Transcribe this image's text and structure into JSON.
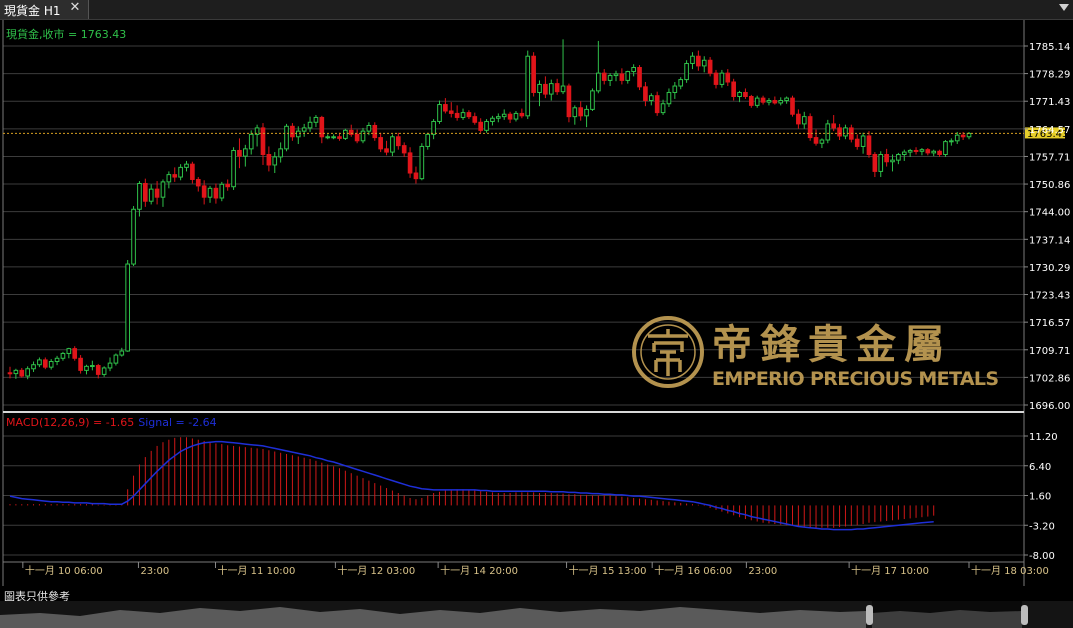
{
  "window": {
    "tab_title": "現貨金 H1",
    "close_icon": "close-icon",
    "dropdown_icon": "triangle-down-icon"
  },
  "price_panel": {
    "legend_symbol": "現貨金,收市",
    "legend_value": "1763.43",
    "y_ticks": [
      "1785.14",
      "1778.29",
      "1771.43",
      "1764.57",
      "1757.71",
      "1750.86",
      "1744.00",
      "1737.14",
      "1730.29",
      "1723.43",
      "1716.57",
      "1709.71",
      "1702.86",
      "1696.00"
    ],
    "current_price": "1763.43"
  },
  "macd_panel": {
    "legend_name": "MACD(12,26,9) = -1.65",
    "legend_signal": "Signal = -2.64",
    "y_ticks": [
      "11.20",
      "6.40",
      "1.60",
      "-3.20",
      "-8.00"
    ]
  },
  "x_ticks": [
    "十一月 10 06:00",
    "23:00",
    "十一月 11 10:00",
    "十一月 12 03:00",
    "十一月 14 20:00",
    "十一月 15 13:00",
    "十一月 16 06:00",
    "23:00",
    "十一月 17 10:00",
    "十一月 18 03:00"
  ],
  "watermark": {
    "brand_cn": "帝鋒貴金屬",
    "brand_en": "EMPERIO PRECIOUS METALS",
    "logo_icon": "emperio-logo-icon"
  },
  "disclaimer": "圖表只供參考",
  "colors": {
    "up": "#2fc14a",
    "down": "#e0151a",
    "grid": "#3c3c3c",
    "axis_text": "#ffffff",
    "legend_price": "#2fc14a",
    "macd_hist": "#d01818",
    "signal_line": "#1e2fd8",
    "current_line": "#d9a020",
    "current_tag": "#e7cf2a",
    "watermark_gold": "#c7a257",
    "xaxis_text": "#d9c38a"
  },
  "chart_data": {
    "type": "candlestick",
    "interval": "H1",
    "ylim": [
      1696.0,
      1788.0
    ],
    "candles": [
      [
        1704.0,
        1705.5,
        1702.6,
        1703.8
      ],
      [
        1703.8,
        1705.0,
        1702.5,
        1704.6
      ],
      [
        1704.6,
        1705.2,
        1702.8,
        1703.2
      ],
      [
        1703.2,
        1705.6,
        1702.4,
        1705.0
      ],
      [
        1705.0,
        1706.8,
        1704.2,
        1706.0
      ],
      [
        1706.0,
        1707.8,
        1705.4,
        1707.2
      ],
      [
        1707.2,
        1707.8,
        1704.9,
        1705.4
      ],
      [
        1705.4,
        1707.4,
        1704.8,
        1706.8
      ],
      [
        1706.8,
        1708.2,
        1705.9,
        1707.6
      ],
      [
        1707.6,
        1709.2,
        1707.0,
        1708.8
      ],
      [
        1708.8,
        1710.2,
        1707.6,
        1710.0
      ],
      [
        1710.0,
        1710.6,
        1707.0,
        1707.6
      ],
      [
        1707.6,
        1708.4,
        1703.8,
        1704.6
      ],
      [
        1704.6,
        1706.0,
        1703.6,
        1705.6
      ],
      [
        1705.6,
        1707.0,
        1704.6,
        1705.8
      ],
      [
        1705.8,
        1706.2,
        1702.6,
        1703.6
      ],
      [
        1703.6,
        1705.6,
        1703.0,
        1705.2
      ],
      [
        1705.2,
        1707.8,
        1704.4,
        1706.4
      ],
      [
        1706.4,
        1708.8,
        1705.8,
        1708.4
      ],
      [
        1708.4,
        1710.2,
        1708.0,
        1709.4
      ],
      [
        1709.4,
        1732.0,
        1709.2,
        1731.0
      ],
      [
        1731.0,
        1745.4,
        1730.5,
        1744.6
      ],
      [
        1744.6,
        1751.6,
        1742.8,
        1751.0
      ],
      [
        1751.0,
        1752.2,
        1745.2,
        1746.6
      ],
      [
        1746.6,
        1750.8,
        1745.8,
        1749.6
      ],
      [
        1749.6,
        1751.6,
        1745.8,
        1747.6
      ],
      [
        1747.6,
        1752.0,
        1745.2,
        1751.4
      ],
      [
        1751.4,
        1754.0,
        1749.8,
        1753.2
      ],
      [
        1753.2,
        1755.0,
        1751.4,
        1752.6
      ],
      [
        1752.6,
        1755.8,
        1751.8,
        1755.0
      ],
      [
        1755.0,
        1756.6,
        1754.0,
        1755.8
      ],
      [
        1755.8,
        1756.4,
        1751.0,
        1752.0
      ],
      [
        1752.0,
        1752.6,
        1749.0,
        1750.4
      ],
      [
        1750.4,
        1751.8,
        1745.8,
        1747.6
      ],
      [
        1747.6,
        1750.4,
        1746.2,
        1749.8
      ],
      [
        1749.8,
        1751.0,
        1746.0,
        1747.4
      ],
      [
        1747.4,
        1751.4,
        1746.6,
        1750.8
      ],
      [
        1750.8,
        1752.0,
        1749.2,
        1750.2
      ],
      [
        1750.2,
        1760.0,
        1749.4,
        1759.2
      ],
      [
        1759.2,
        1762.2,
        1754.8,
        1757.8
      ],
      [
        1757.8,
        1760.6,
        1755.2,
        1759.6
      ],
      [
        1759.6,
        1764.2,
        1758.2,
        1763.2
      ],
      [
        1763.2,
        1765.6,
        1760.2,
        1764.8
      ],
      [
        1764.8,
        1766.0,
        1755.6,
        1758.2
      ],
      [
        1758.2,
        1760.2,
        1754.0,
        1755.6
      ],
      [
        1755.6,
        1758.8,
        1753.6,
        1757.6
      ],
      [
        1757.6,
        1761.2,
        1756.2,
        1759.6
      ],
      [
        1759.6,
        1765.8,
        1759.0,
        1765.2
      ],
      [
        1765.2,
        1766.0,
        1761.6,
        1762.6
      ],
      [
        1762.6,
        1765.2,
        1760.8,
        1764.0
      ],
      [
        1764.0,
        1765.8,
        1762.6,
        1764.8
      ],
      [
        1764.8,
        1767.6,
        1763.8,
        1766.2
      ],
      [
        1766.2,
        1768.0,
        1765.0,
        1767.4
      ],
      [
        1767.4,
        1767.8,
        1761.0,
        1762.6
      ],
      [
        1762.6,
        1763.2,
        1762.0,
        1762.6
      ],
      [
        1762.6,
        1763.2,
        1762.0,
        1762.6
      ],
      [
        1762.6,
        1763.6,
        1761.6,
        1762.2
      ],
      [
        1762.2,
        1764.6,
        1761.8,
        1764.2
      ],
      [
        1764.2,
        1765.6,
        1762.6,
        1763.2
      ],
      [
        1763.2,
        1764.4,
        1761.0,
        1761.6
      ],
      [
        1761.6,
        1764.8,
        1761.0,
        1764.0
      ],
      [
        1764.0,
        1766.2,
        1763.0,
        1765.4
      ],
      [
        1765.4,
        1766.2,
        1761.6,
        1762.4
      ],
      [
        1762.4,
        1763.6,
        1758.8,
        1759.6
      ],
      [
        1759.6,
        1761.6,
        1758.0,
        1758.8
      ],
      [
        1758.8,
        1763.2,
        1757.8,
        1762.6
      ],
      [
        1762.6,
        1763.6,
        1759.4,
        1760.4
      ],
      [
        1760.4,
        1761.2,
        1757.6,
        1758.6
      ],
      [
        1758.6,
        1760.0,
        1752.4,
        1753.6
      ],
      [
        1753.6,
        1755.2,
        1751.0,
        1752.2
      ],
      [
        1752.2,
        1761.0,
        1751.8,
        1760.2
      ],
      [
        1760.2,
        1763.6,
        1759.4,
        1763.2
      ],
      [
        1763.2,
        1767.0,
        1762.0,
        1766.4
      ],
      [
        1766.4,
        1771.6,
        1765.8,
        1770.6
      ],
      [
        1770.6,
        1772.2,
        1768.4,
        1769.0
      ],
      [
        1769.0,
        1771.2,
        1767.4,
        1768.4
      ],
      [
        1768.4,
        1770.4,
        1766.6,
        1767.4
      ],
      [
        1767.4,
        1769.6,
        1766.8,
        1768.6
      ],
      [
        1768.6,
        1769.2,
        1767.0,
        1767.6
      ],
      [
        1767.6,
        1768.6,
        1765.6,
        1766.2
      ],
      [
        1766.2,
        1767.2,
        1763.6,
        1764.2
      ],
      [
        1764.2,
        1767.0,
        1763.6,
        1766.4
      ],
      [
        1766.4,
        1767.8,
        1765.4,
        1767.2
      ],
      [
        1767.2,
        1768.4,
        1766.2,
        1767.6
      ],
      [
        1767.6,
        1769.4,
        1766.8,
        1768.2
      ],
      [
        1768.2,
        1768.8,
        1766.0,
        1767.0
      ],
      [
        1767.0,
        1769.0,
        1766.4,
        1768.4
      ],
      [
        1768.4,
        1769.6,
        1767.2,
        1767.8
      ],
      [
        1767.8,
        1784.0,
        1767.0,
        1782.6
      ],
      [
        1782.6,
        1783.6,
        1772.6,
        1773.6
      ],
      [
        1773.6,
        1776.6,
        1770.2,
        1775.6
      ],
      [
        1775.6,
        1777.6,
        1772.2,
        1773.2
      ],
      [
        1773.2,
        1776.8,
        1771.6,
        1775.8
      ],
      [
        1775.8,
        1777.0,
        1773.0,
        1773.8
      ],
      [
        1773.8,
        1786.8,
        1773.2,
        1775.2
      ],
      [
        1775.2,
        1775.8,
        1766.2,
        1767.6
      ],
      [
        1767.6,
        1770.4,
        1765.6,
        1769.8
      ],
      [
        1769.8,
        1771.4,
        1766.6,
        1767.8
      ],
      [
        1767.8,
        1770.4,
        1765.0,
        1769.4
      ],
      [
        1769.4,
        1774.6,
        1769.0,
        1774.0
      ],
      [
        1774.0,
        1786.4,
        1773.4,
        1778.4
      ],
      [
        1778.4,
        1779.4,
        1775.6,
        1776.6
      ],
      [
        1776.6,
        1778.4,
        1775.2,
        1777.8
      ],
      [
        1777.8,
        1779.0,
        1776.4,
        1778.2
      ],
      [
        1778.2,
        1779.6,
        1775.6,
        1776.6
      ],
      [
        1776.6,
        1779.0,
        1775.8,
        1778.8
      ],
      [
        1778.8,
        1780.6,
        1777.6,
        1779.8
      ],
      [
        1779.8,
        1780.4,
        1774.2,
        1775.0
      ],
      [
        1775.0,
        1776.2,
        1770.2,
        1771.6
      ],
      [
        1771.6,
        1773.4,
        1770.4,
        1772.8
      ],
      [
        1772.8,
        1773.8,
        1767.8,
        1768.6
      ],
      [
        1768.6,
        1771.8,
        1768.0,
        1770.8
      ],
      [
        1770.8,
        1774.6,
        1770.0,
        1773.6
      ],
      [
        1773.6,
        1776.2,
        1772.0,
        1775.2
      ],
      [
        1775.2,
        1777.4,
        1774.4,
        1776.8
      ],
      [
        1776.8,
        1781.6,
        1776.0,
        1780.8
      ],
      [
        1780.8,
        1783.6,
        1779.4,
        1782.6
      ],
      [
        1782.6,
        1784.0,
        1779.0,
        1780.2
      ],
      [
        1780.2,
        1782.6,
        1778.6,
        1781.6
      ],
      [
        1781.6,
        1782.4,
        1777.6,
        1778.4
      ],
      [
        1778.4,
        1779.2,
        1774.6,
        1775.6
      ],
      [
        1775.6,
        1779.2,
        1774.8,
        1778.4
      ],
      [
        1778.4,
        1779.4,
        1775.2,
        1776.2
      ],
      [
        1776.2,
        1777.0,
        1771.6,
        1772.6
      ],
      [
        1772.6,
        1774.0,
        1771.2,
        1773.6
      ],
      [
        1773.6,
        1774.6,
        1772.0,
        1772.6
      ],
      [
        1772.6,
        1773.0,
        1769.8,
        1770.4
      ],
      [
        1770.4,
        1772.8,
        1769.8,
        1772.2
      ],
      [
        1772.2,
        1772.8,
        1770.6,
        1771.2
      ],
      [
        1771.2,
        1772.2,
        1770.4,
        1771.6
      ],
      [
        1771.6,
        1772.6,
        1770.6,
        1771.0
      ],
      [
        1771.0,
        1772.4,
        1770.4,
        1771.6
      ],
      [
        1771.6,
        1772.6,
        1770.8,
        1772.2
      ],
      [
        1772.2,
        1772.8,
        1767.6,
        1768.2
      ],
      [
        1768.2,
        1769.4,
        1764.6,
        1765.8
      ],
      [
        1765.8,
        1768.8,
        1764.6,
        1767.6
      ],
      [
        1767.6,
        1768.4,
        1761.6,
        1762.4
      ],
      [
        1762.4,
        1764.4,
        1760.4,
        1761.0
      ],
      [
        1761.0,
        1762.2,
        1759.8,
        1761.8
      ],
      [
        1761.8,
        1766.8,
        1761.0,
        1765.8
      ],
      [
        1765.8,
        1768.0,
        1764.0,
        1764.8
      ],
      [
        1764.8,
        1765.8,
        1761.8,
        1762.8
      ],
      [
        1762.8,
        1765.6,
        1762.0,
        1764.8
      ],
      [
        1764.8,
        1765.6,
        1761.2,
        1762.0
      ],
      [
        1762.0,
        1763.2,
        1759.4,
        1760.2
      ],
      [
        1760.2,
        1763.6,
        1758.4,
        1762.8
      ],
      [
        1762.8,
        1764.0,
        1757.4,
        1758.2
      ],
      [
        1758.2,
        1758.8,
        1752.6,
        1754.0
      ],
      [
        1754.0,
        1759.0,
        1752.6,
        1758.2
      ],
      [
        1758.2,
        1759.6,
        1755.2,
        1756.4
      ],
      [
        1756.4,
        1758.2,
        1754.0,
        1756.8
      ],
      [
        1756.8,
        1758.6,
        1755.8,
        1758.2
      ],
      [
        1758.2,
        1759.4,
        1756.6,
        1758.8
      ],
      [
        1758.8,
        1759.6,
        1757.6,
        1759.2
      ],
      [
        1759.2,
        1760.0,
        1758.2,
        1759.0
      ],
      [
        1759.0,
        1759.8,
        1758.0,
        1759.4
      ],
      [
        1759.4,
        1759.8,
        1758.0,
        1758.6
      ],
      [
        1758.6,
        1759.4,
        1757.8,
        1759.0
      ],
      [
        1759.0,
        1759.4,
        1757.6,
        1758.2
      ],
      [
        1758.2,
        1761.8,
        1757.6,
        1761.4
      ],
      [
        1761.4,
        1762.2,
        1760.4,
        1761.6
      ],
      [
        1761.6,
        1763.8,
        1760.8,
        1763.0
      ],
      [
        1763.0,
        1763.8,
        1761.8,
        1762.6
      ],
      [
        1762.6,
        1763.8,
        1762.0,
        1763.43
      ]
    ],
    "macd": {
      "ylim": [
        -10.0,
        13.0
      ],
      "histogram": [
        0.2,
        0.2,
        0.2,
        0.2,
        0.2,
        0.2,
        0.2,
        0.2,
        0.2,
        0.2,
        0.2,
        0.2,
        0.2,
        0.2,
        0.2,
        0.1,
        0.1,
        0.1,
        0.1,
        0.2,
        2.6,
        4.8,
        6.6,
        7.8,
        8.8,
        9.6,
        10.2,
        10.6,
        10.9,
        11.0,
        11.0,
        10.8,
        10.6,
        10.4,
        10.2,
        10.0,
        9.9,
        9.7,
        9.6,
        9.5,
        9.4,
        9.3,
        9.2,
        9.1,
        8.9,
        8.7,
        8.5,
        8.3,
        8.1,
        7.9,
        7.7,
        7.5,
        7.2,
        6.9,
        6.6,
        6.3,
        6.0,
        5.6,
        5.2,
        4.8,
        4.4,
        4.0,
        3.6,
        3.2,
        2.8,
        2.4,
        2.0,
        1.6,
        1.2,
        1.0,
        1.2,
        1.6,
        2.0,
        2.2,
        2.4,
        2.5,
        2.6,
        2.6,
        2.5,
        2.4,
        2.3,
        2.2,
        2.1,
        2.0,
        2.0,
        2.0,
        2.1,
        2.1,
        2.1,
        2.1,
        2.0,
        2.0,
        2.0,
        1.9,
        1.9,
        1.8,
        1.8,
        1.7,
        1.7,
        1.6,
        1.6,
        1.6,
        1.6,
        1.5,
        1.4,
        1.3,
        1.2,
        1.1,
        1.0,
        0.9,
        0.8,
        0.7,
        0.6,
        0.5,
        0.4,
        0.3,
        0.2,
        0.1,
        -0.1,
        -0.4,
        -0.7,
        -1.0,
        -1.3,
        -1.6,
        -1.9,
        -2.2,
        -2.4,
        -2.6,
        -2.8,
        -2.9,
        -3.0,
        -3.1,
        -3.2,
        -3.3,
        -3.4,
        -3.4,
        -3.5,
        -3.6,
        -3.6,
        -3.6,
        -3.6,
        -3.5,
        -3.4,
        -3.3,
        -3.2,
        -3.0,
        -2.8,
        -2.7,
        -2.6,
        -2.5,
        -2.4,
        -2.3,
        -2.2,
        -2.1,
        -2.0,
        -1.9,
        -1.8,
        -1.65
      ],
      "signal": [
        1.5,
        1.3,
        1.1,
        1.0,
        0.9,
        0.8,
        0.7,
        0.6,
        0.6,
        0.5,
        0.5,
        0.4,
        0.4,
        0.4,
        0.3,
        0.3,
        0.3,
        0.2,
        0.2,
        0.2,
        0.7,
        1.5,
        2.5,
        3.5,
        4.5,
        5.5,
        6.4,
        7.3,
        8.0,
        8.7,
        9.2,
        9.6,
        9.9,
        10.1,
        10.2,
        10.3,
        10.3,
        10.2,
        10.1,
        10.0,
        9.9,
        9.8,
        9.7,
        9.6,
        9.4,
        9.2,
        9.0,
        8.8,
        8.6,
        8.4,
        8.2,
        8.0,
        7.7,
        7.5,
        7.2,
        7.0,
        6.7,
        6.4,
        6.1,
        5.8,
        5.5,
        5.2,
        4.9,
        4.6,
        4.3,
        4.0,
        3.7,
        3.4,
        3.1,
        2.9,
        2.7,
        2.6,
        2.5,
        2.5,
        2.5,
        2.5,
        2.5,
        2.5,
        2.5,
        2.5,
        2.4,
        2.4,
        2.3,
        2.3,
        2.3,
        2.3,
        2.3,
        2.3,
        2.3,
        2.3,
        2.3,
        2.3,
        2.2,
        2.2,
        2.2,
        2.1,
        2.1,
        2.0,
        2.0,
        1.9,
        1.9,
        1.8,
        1.8,
        1.7,
        1.7,
        1.6,
        1.5,
        1.5,
        1.4,
        1.3,
        1.2,
        1.1,
        1.0,
        0.9,
        0.8,
        0.7,
        0.6,
        0.4,
        0.2,
        0.0,
        -0.3,
        -0.5,
        -0.8,
        -1.0,
        -1.3,
        -1.5,
        -1.8,
        -2.0,
        -2.2,
        -2.4,
        -2.6,
        -2.8,
        -3.0,
        -3.2,
        -3.4,
        -3.5,
        -3.6,
        -3.7,
        -3.8,
        -3.8,
        -3.9,
        -3.9,
        -3.9,
        -3.9,
        -3.8,
        -3.8,
        -3.7,
        -3.6,
        -3.5,
        -3.4,
        -3.3,
        -3.2,
        -3.1,
        -3.0,
        -2.9,
        -2.8,
        -2.7,
        -2.64
      ]
    }
  }
}
